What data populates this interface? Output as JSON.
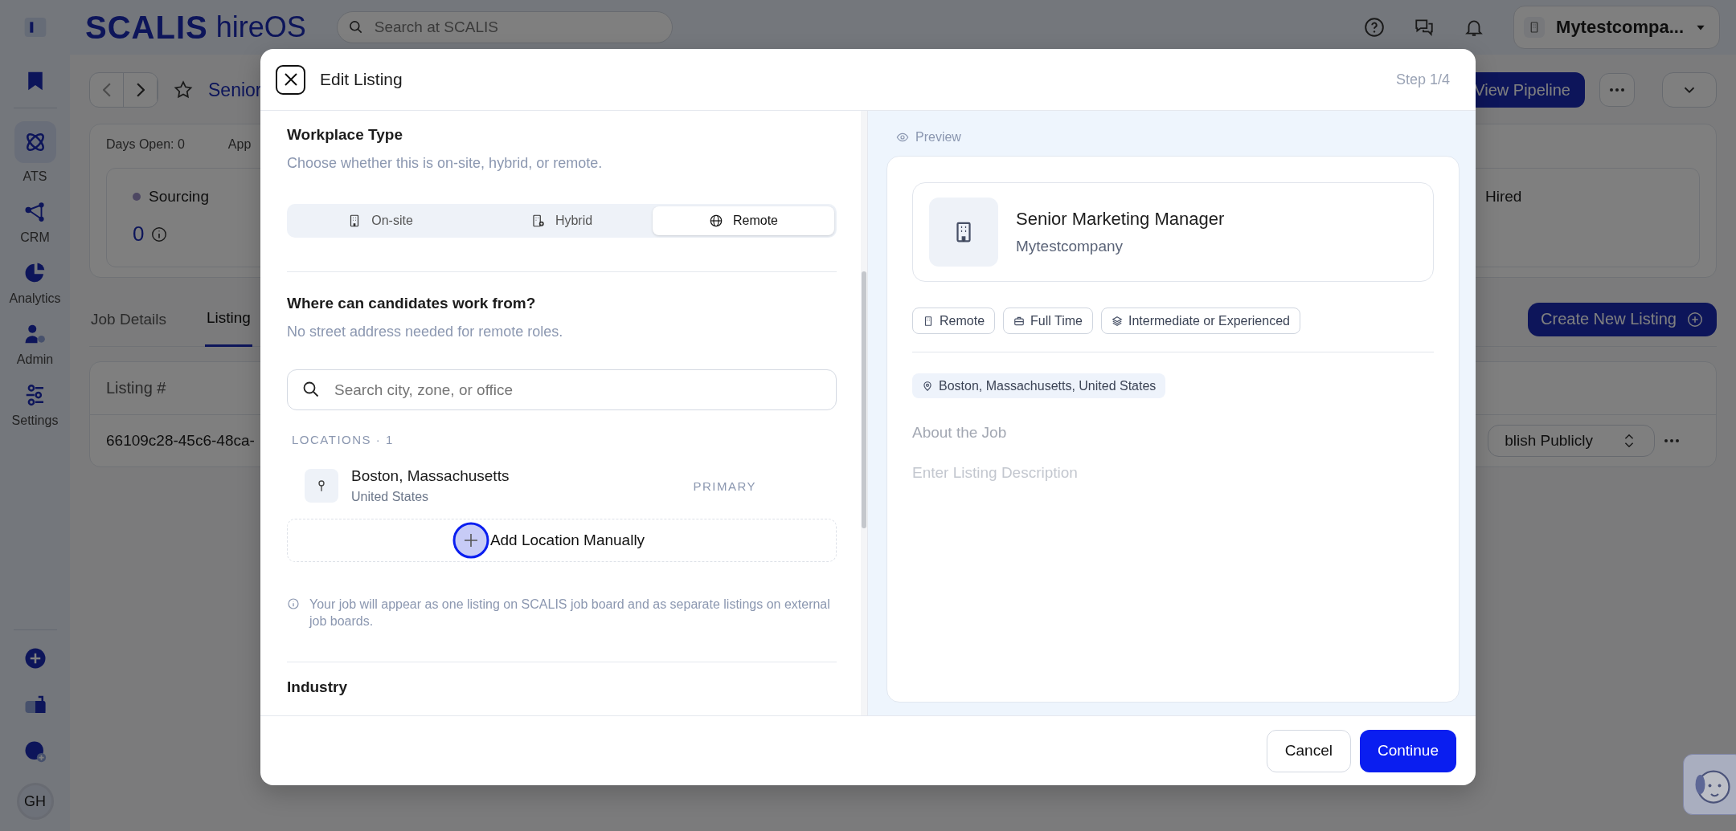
{
  "topbar": {
    "brand": "SCALIS",
    "product": "hireOS",
    "search_placeholder": "Search at SCALIS",
    "company": "Mytestcompa..."
  },
  "sidebar": {
    "items": [
      {
        "label": "ATS",
        "kind": "ats",
        "selected": true
      },
      {
        "label": "CRM",
        "kind": "crm",
        "selected": false
      },
      {
        "label": "Analytics",
        "kind": "analytics",
        "selected": false
      },
      {
        "label": "Admin",
        "kind": "admin",
        "selected": false
      },
      {
        "label": "Settings",
        "kind": "settings",
        "selected": false
      }
    ],
    "avatar": "GH"
  },
  "job": {
    "title": "Senior",
    "view_pipeline": "View Pipeline",
    "stats": [
      "Days Open: 0",
      "App"
    ],
    "stages": [
      {
        "name": "Sourcing",
        "count": "0",
        "color": "#4d4762"
      },
      {
        "name": "Hired"
      }
    ],
    "tabs": [
      {
        "label": "Job Details",
        "selected": false
      },
      {
        "label": "Listing",
        "selected": true
      }
    ],
    "create_button": "Create New Listing",
    "table": {
      "columns": [
        "Listing #"
      ],
      "rows": [
        {
          "id": "66109c28-45c6-48ca-",
          "status": "blish Publicly"
        }
      ]
    }
  },
  "modal": {
    "title": "Edit Listing",
    "step": "Step 1/4",
    "workplace": {
      "title": "Workplace Type",
      "hint": "Choose whether this is on-site, hybrid, or remote.",
      "options": [
        {
          "label": "On-site",
          "kind": "building",
          "selected": false
        },
        {
          "label": "Hybrid",
          "kind": "hybrid",
          "selected": false
        },
        {
          "label": "Remote",
          "kind": "globe",
          "selected": true
        }
      ]
    },
    "location": {
      "title": "Where can candidates work from?",
      "hint": "No street address needed for remote roles.",
      "search_placeholder": "Search city, zone, or office",
      "count_label": "LOCATIONS · 1",
      "items": [
        {
          "name": "Boston, Massachusetts",
          "country": "United States",
          "badge": "PRIMARY"
        }
      ],
      "add_button": "Add Location Manually",
      "note": "Your job will appear as one listing on SCALIS job board and as separate listings on external job boards."
    },
    "next_section": "Industry",
    "preview": {
      "label": "Preview",
      "title": "Senior Marketing Manager",
      "company": "Mytestcompany",
      "tags": [
        {
          "label": "Remote",
          "kind": "building"
        },
        {
          "label": "Full Time",
          "kind": "briefcase"
        },
        {
          "label": "Intermediate or Experienced",
          "kind": "layers"
        }
      ],
      "location": "Boston, Massachusetts, United States",
      "about_title": "About the Job",
      "description_placeholder": "Enter Listing Description"
    },
    "cancel": "Cancel",
    "continue": "Continue"
  }
}
